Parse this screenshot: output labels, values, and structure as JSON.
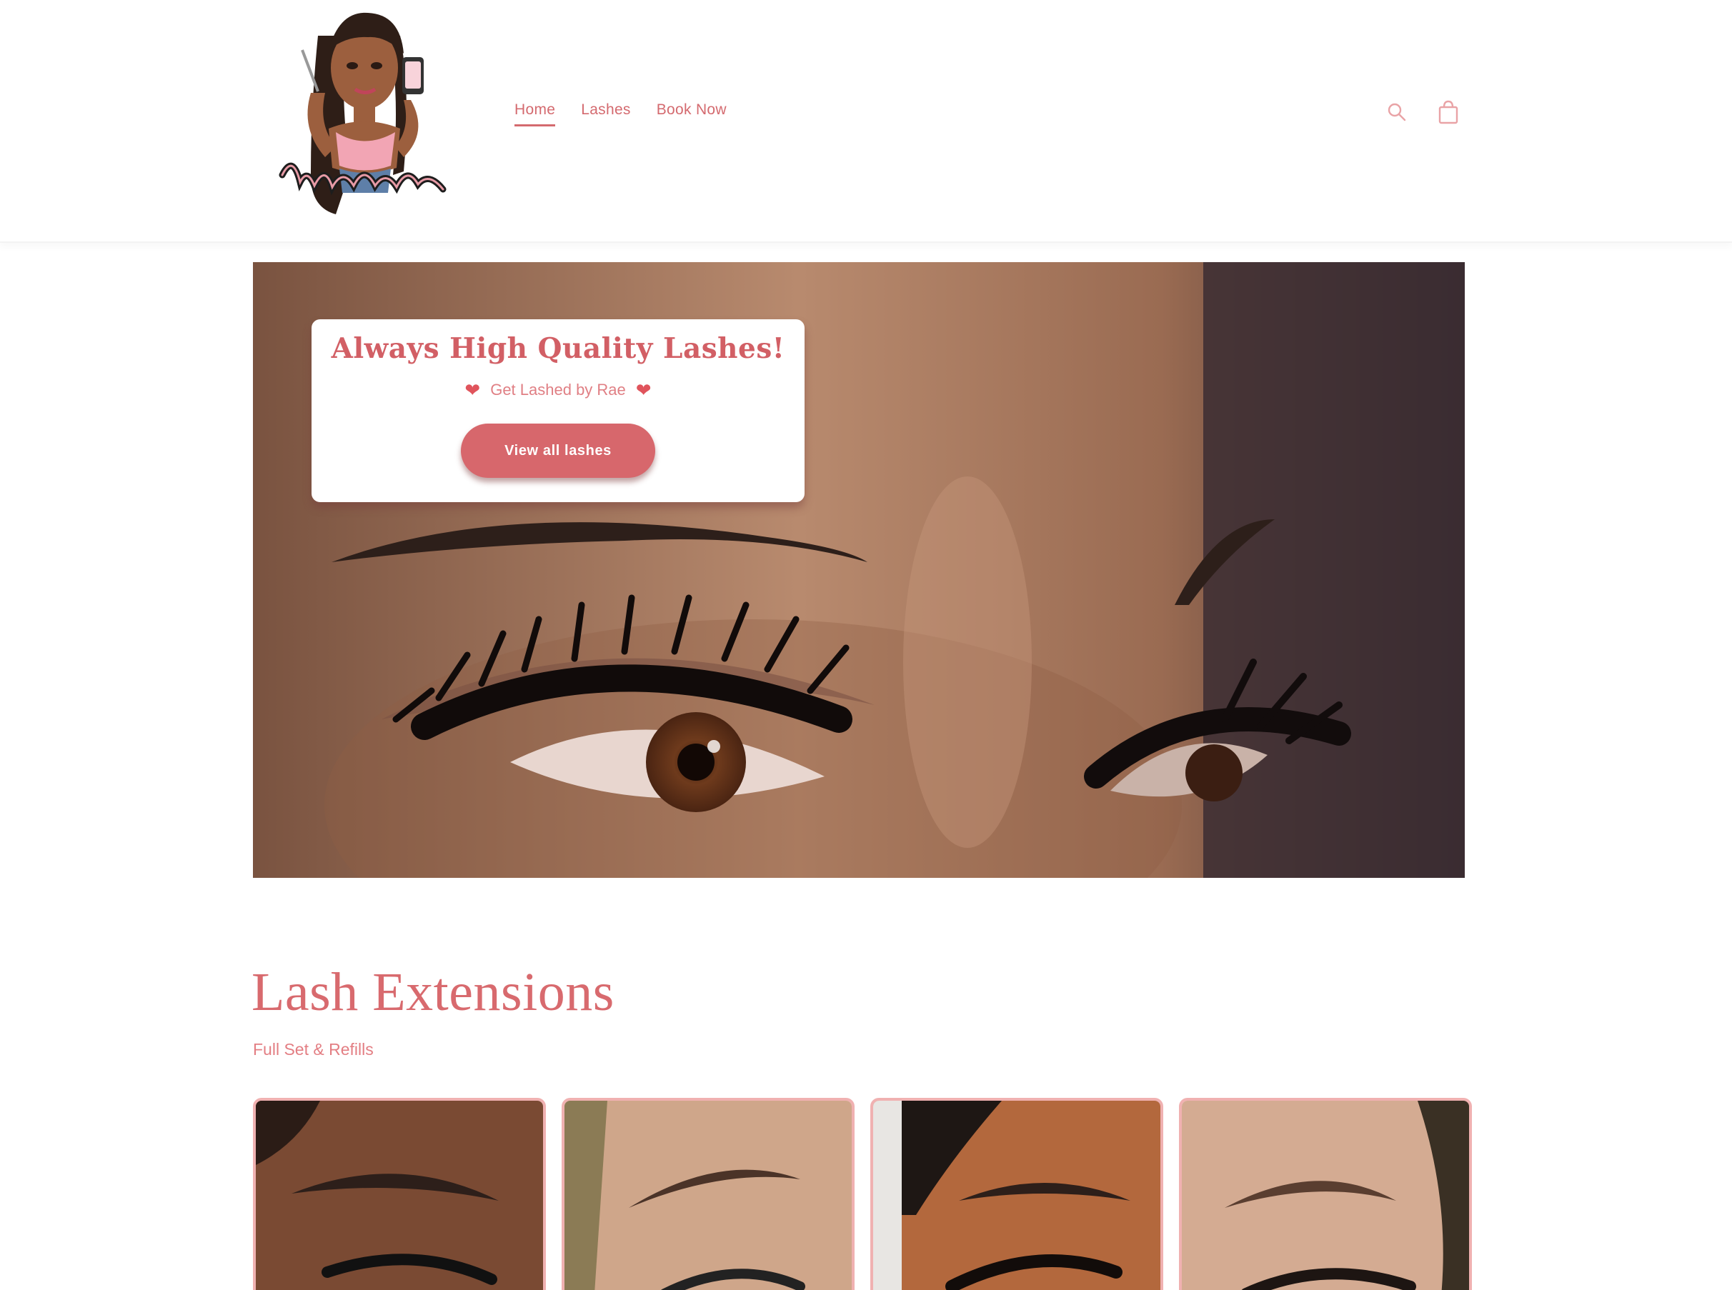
{
  "header": {
    "logo_alt": "Lashed by Rae",
    "nav": [
      {
        "label": "Home",
        "active": true
      },
      {
        "label": "Lashes",
        "active": false
      },
      {
        "label": "Book Now",
        "active": false
      }
    ],
    "icons": [
      "search-icon",
      "cart-icon"
    ]
  },
  "hero": {
    "title": "Always High Quality Lashes!",
    "subtitle": "Get Lashed by Rae",
    "button_label": "View all lashes"
  },
  "collection": {
    "title": "Lash Extensions",
    "subtitle": "Full Set & Refills",
    "cards": [
      {
        "name": "lash-card-1",
        "skin": "#7a4a33"
      },
      {
        "name": "lash-card-2",
        "skin": "#cfa68a"
      },
      {
        "name": "lash-card-3",
        "skin": "#b3683d"
      },
      {
        "name": "lash-card-4",
        "skin": "#d4ab92"
      }
    ]
  },
  "colors": {
    "accent": "#d7676c",
    "text_pink": "#d25f65",
    "card_border": "#f0b1b1"
  }
}
